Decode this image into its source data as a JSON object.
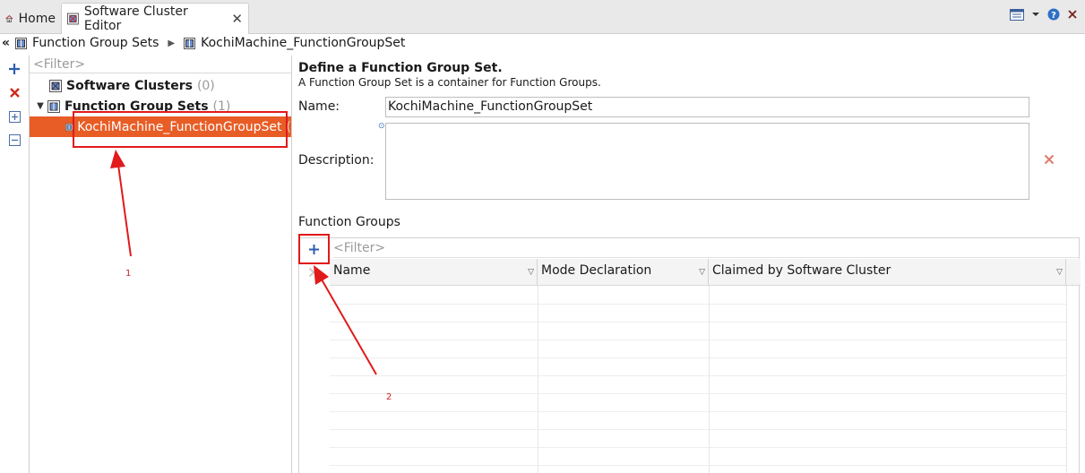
{
  "tabs": [
    {
      "label": "Home",
      "icon": "home-icon"
    },
    {
      "label": "Software Cluster Editor",
      "icon": "cluster-editor-icon",
      "close": "✕"
    }
  ],
  "toolbar_right": {
    "menu_icon": "view-menu-icon",
    "help_icon": "help-icon",
    "close_icon": "close-icon"
  },
  "breadcrumb": {
    "back": "«",
    "items": [
      "Function Group Sets",
      "KochiMachine_FunctionGroupSet"
    ]
  },
  "tree": {
    "filter_placeholder": "<Filter>",
    "items": [
      {
        "label": "Software Clusters",
        "count": "(0)"
      },
      {
        "label": "Function Group Sets",
        "count": "(1)",
        "expanded": true
      },
      {
        "label": "KochiMachine_FunctionGroupSet",
        "count": "(",
        "selected": true
      }
    ]
  },
  "form": {
    "heading": "Define a Function Group Set.",
    "subheading": "A Function Group Set is a container for Function Groups.",
    "name_label": "Name:",
    "name_value": "KochiMachine_FunctionGroupSet",
    "description_label": "Description:",
    "description_value": "",
    "function_groups_label": "Function Groups",
    "fg_filter_placeholder": "<Filter>",
    "columns": [
      "Name",
      "Mode Declaration",
      "Claimed by Software Cluster"
    ]
  },
  "annotations": {
    "one": "1",
    "two": "2"
  },
  "colors": {
    "selection": "#e85d26",
    "annotation": "#e11a1a"
  }
}
